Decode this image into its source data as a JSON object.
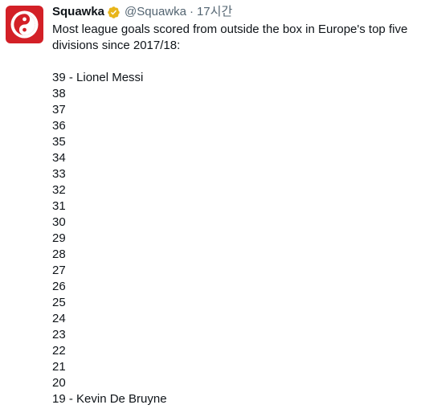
{
  "author": {
    "display_name": "Squawka",
    "handle": "@Squawka",
    "separator": "·",
    "time": "17시간",
    "verified_icon": "verified-badge-icon",
    "avatar_icon": "squawka-logo-icon",
    "avatar_color": "#d32027",
    "verified_color": "#e8b51a"
  },
  "tweet": {
    "headline": [
      "Most league goals scored from outside the box in Europe's top five",
      "divisions since 2017/18:"
    ],
    "list": [
      "39 - Lionel Messi",
      "38",
      "37",
      "36",
      "35",
      "34",
      "33",
      "32",
      "31",
      "30",
      "29",
      "28",
      "27",
      "26",
      "25",
      "24",
      "23",
      "22",
      "21",
      "20",
      "19 - Kevin De Bruyne"
    ]
  }
}
